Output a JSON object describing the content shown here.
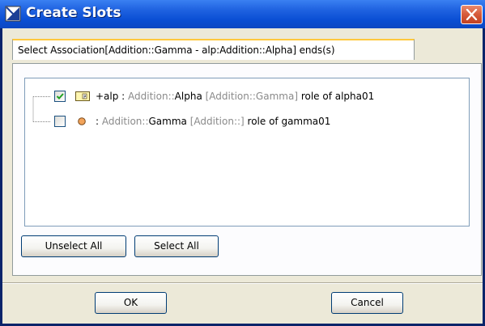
{
  "window": {
    "title": "Create Slots"
  },
  "tab": {
    "label": "Select Association[Addition::Gamma - alp:Addition::Alpha] ends(s)"
  },
  "tree": {
    "items": [
      {
        "checked": true,
        "icon": "property-icon",
        "name": "+alp : ",
        "type_scope": "Addition::",
        "type_name": "Alpha",
        "owner": " [Addition::Gamma]",
        "role": " role of alpha01"
      },
      {
        "checked": false,
        "icon": "class-instance-icon",
        "name": " : ",
        "type_scope": "Addition::",
        "type_name": "Gamma",
        "owner": " [Addition::]",
        "role": " role of gamma01"
      }
    ]
  },
  "buttons": {
    "unselect_all": "Unselect All",
    "select_all": "Select All",
    "ok": "OK",
    "cancel": "Cancel"
  },
  "colors": {
    "title_bar": "#0a4fd4",
    "dialog_bg": "#ece9d8",
    "tab_highlight": "#ffc83c",
    "close_button": "#d65a3a",
    "checkmark": "#21a121",
    "secondary_text": "#8a8a8a"
  }
}
